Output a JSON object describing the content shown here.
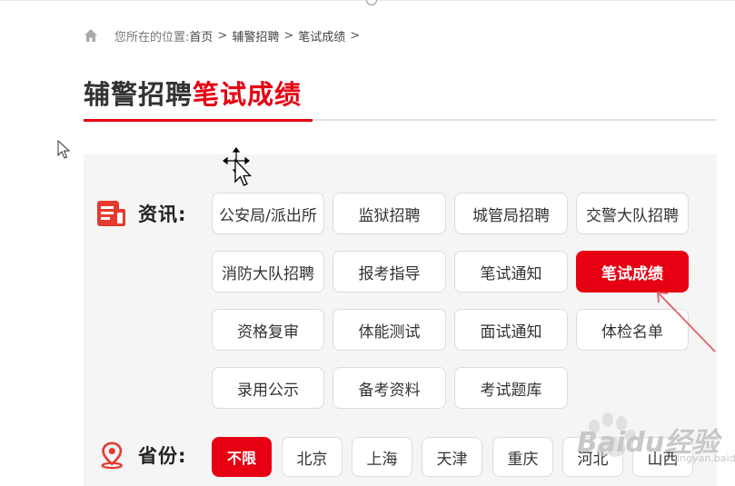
{
  "breadcrumb": {
    "location_label": "您所在的位置:",
    "items": [
      "首页",
      "辅警招聘",
      "笔试成绩"
    ],
    "separator": ">"
  },
  "title": {
    "part1": "辅警招聘",
    "part2": "笔试成绩"
  },
  "news": {
    "label": "资讯:",
    "tags": [
      "公安局/派出所",
      "监狱招聘",
      "城管局招聘",
      "交警大队招聘",
      "消防大队招聘",
      "报考指导",
      "笔试通知",
      "笔试成绩",
      "资格复审",
      "体能测试",
      "面试通知",
      "体检名单",
      "录用公示",
      "备考资料",
      "考试题库"
    ],
    "active": "笔试成绩"
  },
  "province": {
    "label": "省份:",
    "tags": [
      "不限",
      "北京",
      "上海",
      "天津",
      "重庆",
      "河北",
      "山西"
    ],
    "active": "不限"
  },
  "watermark": {
    "text": "Baidu经验",
    "sub": "jingyan.baidu.com"
  },
  "colors": {
    "accent": "#e60012",
    "panel": "#f5f5f5",
    "text": "#333333"
  },
  "icons": [
    "home-icon",
    "news-icon",
    "location-pin-icon",
    "arrow-cursor-icon",
    "move-cursor-icon"
  ]
}
